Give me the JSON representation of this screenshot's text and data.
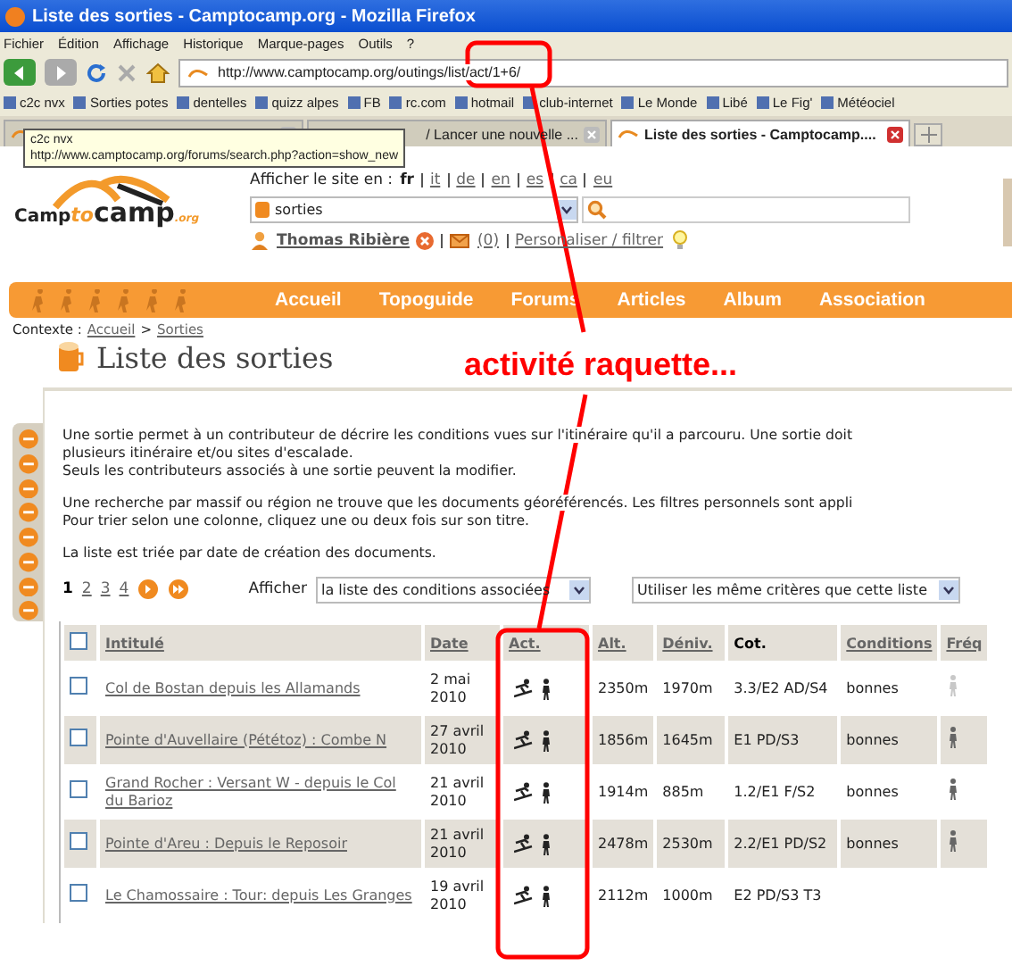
{
  "window": {
    "title": "Liste des sorties - Camptocamp.org - Mozilla Firefox"
  },
  "menu": [
    "Fichier",
    "Édition",
    "Affichage",
    "Historique",
    "Marque-pages",
    "Outils",
    "?"
  ],
  "address_bar": {
    "value": "http://www.camptocamp.org/outings/list/act/1+6/"
  },
  "bookmarks": [
    "c2c nvx",
    "Sorties potes",
    "dentelles",
    "quizz alpes",
    "FB",
    "rc.com",
    "hotmail",
    "club-internet",
    "Le Monde",
    "Libé",
    "Le Fig'",
    "Météociel"
  ],
  "tabs": [
    {
      "selected": false
    },
    {
      "label": "/ Lancer une nouvelle ...",
      "selected": false
    },
    {
      "label": "Liste des sorties - Camptocamp....",
      "selected": true
    }
  ],
  "tooltip": [
    "c2c nvx",
    "http://www.camptocamp.org/forums/search.php?action=show_new"
  ],
  "logo": {
    "part_1": "Camp",
    "part_2": "to",
    "part_3": "camp",
    "part_4": ".org"
  },
  "language": {
    "label": "Afficher le site en :",
    "options": [
      {
        "label": "fr",
        "selected": true
      },
      {
        "label": "it",
        "selected": false
      },
      {
        "label": "de",
        "selected": false
      },
      {
        "label": "en",
        "selected": false
      },
      {
        "label": "es",
        "selected": false
      },
      {
        "label": "ca",
        "selected": false
      },
      {
        "label": "eu",
        "selected": false
      }
    ]
  },
  "search": {
    "category": "sorties"
  },
  "user": {
    "name": "Thomas Ribière",
    "messages": "(0)",
    "customize": "Personaliser / filtrer"
  },
  "nav": [
    "Accueil",
    "Topoguide",
    "Forums",
    "Articles",
    "Album",
    "Association"
  ],
  "breadcrumb": {
    "label": "Contexte :",
    "items": [
      "Accueil",
      "Sorties"
    ],
    "separator": ">"
  },
  "heading": "Liste des sorties",
  "paragraphs": [
    [
      "Une sortie permet à un contributeur de décrire les conditions vues sur l'itinéraire qu'il a parcouru. Une sortie doit",
      "plusieurs itinéraire et/ou sites d'escalade.",
      "Seuls les contributeurs associés à une sortie peuvent la modifier."
    ],
    [
      "Une recherche par massif ou région ne trouve que les documents géoréférencés. Les filtres personnels sont appli",
      "Pour trier selon une colonne, cliquez une ou deux fois sur son titre."
    ],
    [
      "La liste est triée par date de création des documents."
    ]
  ],
  "pagination": [
    {
      "label": "1",
      "selected": true
    },
    {
      "label": "2",
      "selected": false
    },
    {
      "label": "3",
      "selected": false
    },
    {
      "label": "4",
      "selected": false
    }
  ],
  "display": {
    "label": "Afficher",
    "value": "la liste des conditions associées"
  },
  "criteria": {
    "value": "Utiliser les même critères que cette liste"
  },
  "annotation": "activité raquette...",
  "table": {
    "select_all": {
      "checked": false
    },
    "columns": [
      "Intitulé",
      "Date",
      "Act.",
      "Alt.",
      "Déniv.",
      "Cot.",
      "Conditions",
      "Fréq"
    ],
    "rows": [
      {
        "checked": false,
        "title": "Col de Bostan depuis les Allamands",
        "date": [
          "2 mai",
          "2010"
        ],
        "alt": "2350m",
        "deniv": "1970m",
        "cot": "3.3/E2 AD/S4",
        "conditions": "bonnes",
        "frequented": false
      },
      {
        "checked": false,
        "title": "Pointe d'Auvellaire (Pététoz) : Combe N",
        "date": [
          "27 avril",
          "2010"
        ],
        "alt": "1856m",
        "deniv": "1645m",
        "cot": "E1 PD/S3",
        "conditions": "bonnes",
        "frequented": true
      },
      {
        "checked": false,
        "title": "Grand Rocher : Versant W - depuis le Col du Barioz",
        "date": [
          "21 avril",
          "2010"
        ],
        "alt": "1914m",
        "deniv": "885m",
        "cot": "1.2/E1 F/S2",
        "conditions": "bonnes",
        "frequented": true
      },
      {
        "checked": false,
        "title": "Pointe d'Areu : Depuis le Reposoir",
        "date": [
          "21 avril",
          "2010"
        ],
        "alt": "2478m",
        "deniv": "2530m",
        "cot": "2.2/E1 PD/S2",
        "conditions": "bonnes",
        "frequented": true
      },
      {
        "checked": false,
        "title": "Le Chamossaire : Tour: depuis Les Granges",
        "date": [
          "19 avril",
          "2010"
        ],
        "alt": "2112m",
        "deniv": "1000m",
        "cot": "E2 PD/S3 T3"
      }
    ]
  }
}
